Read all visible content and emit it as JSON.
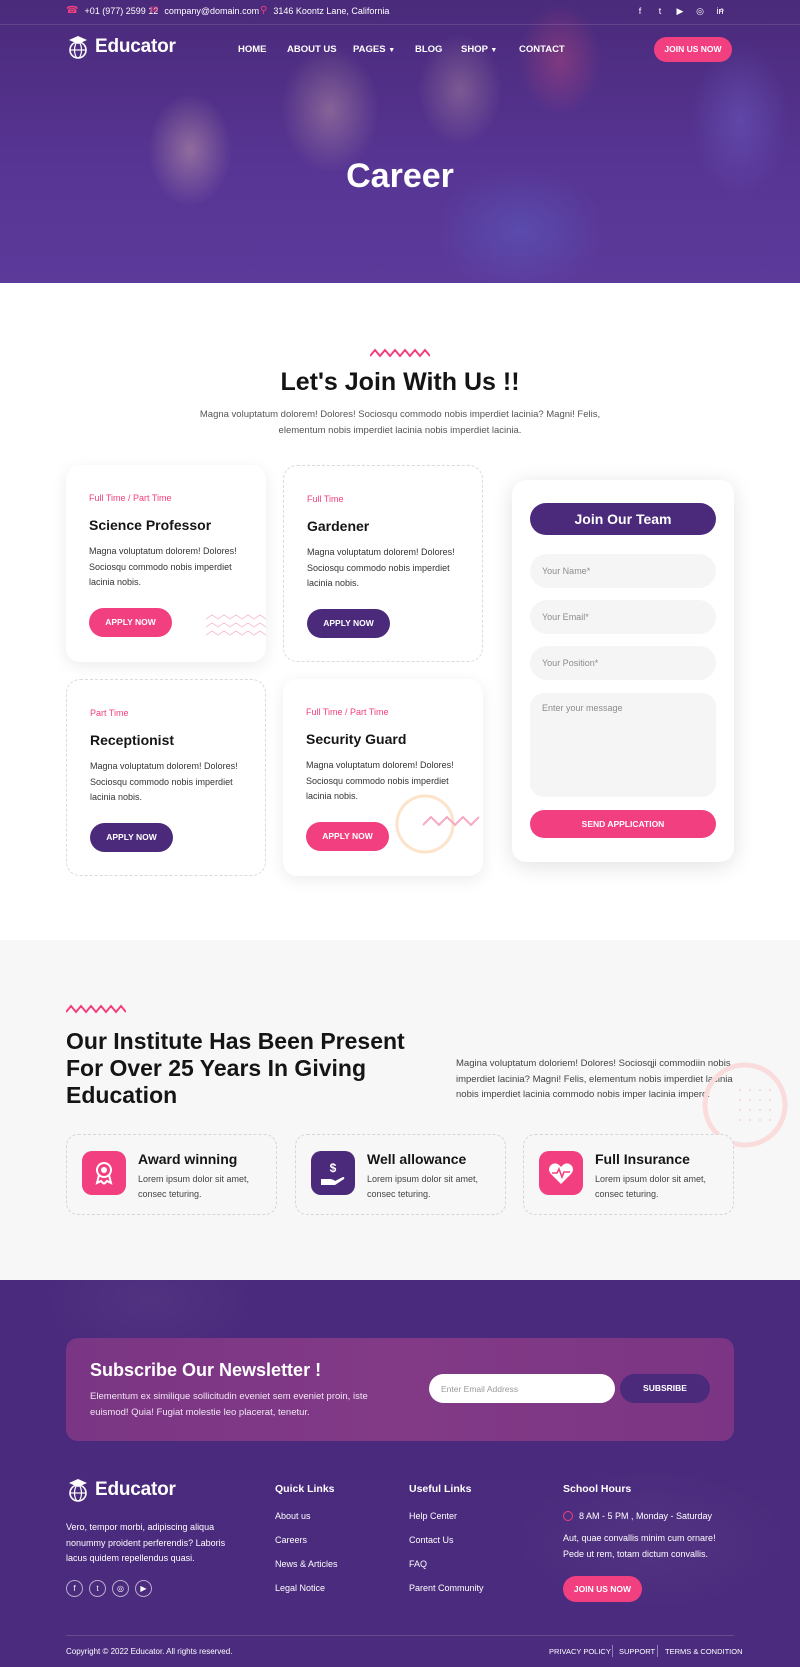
{
  "topbar": {
    "phone": "+01 (977) 2599 12",
    "email": "company@domain.com",
    "address": "3146 Koontz Lane, California",
    "social_icons": [
      "facebook-icon",
      "twitter-icon",
      "youtube-icon",
      "instagram-icon",
      "linkedin-icon",
      "search-icon"
    ]
  },
  "brand": {
    "name": "Educator"
  },
  "nav": {
    "home": "HOME",
    "about": "ABOUT US",
    "pages": "PAGES",
    "blog": "BLOG",
    "shop": "SHOP",
    "contact": "CONTACT",
    "join": "JOIN US NOW"
  },
  "hero": {
    "title": "Career"
  },
  "join_section": {
    "title": "Let's Join With Us !!",
    "subtitle_line1": "Magna voluptatum dolorem! Dolores! Sociosqu commodo nobis imperdiet lacinia? Magni! Felis,",
    "subtitle_line2": "elementum nobis imperdiet lacinia nobis imperdiet lacinia.",
    "jobs": [
      {
        "type": "Full Time / Part Time",
        "title": "Science Professor",
        "desc": "Magna voluptatum dolorem! Dolores! Sociosqu commodo nobis imperdiet lacinia nobis.",
        "button": "APPLY NOW"
      },
      {
        "type": "Full Time",
        "title": "Gardener",
        "desc": "Magna voluptatum dolorem! Dolores! Sociosqu commodo nobis imperdiet lacinia nobis.",
        "button": "APPLY NOW"
      },
      {
        "type": "Part Time",
        "title": "Receptionist",
        "desc": "Magna voluptatum dolorem! Dolores! Sociosqu commodo nobis imperdiet lacinia nobis.",
        "button": "APPLY NOW"
      },
      {
        "type": "Full Time / Part Time",
        "title": "Security Guard",
        "desc": "Magna voluptatum dolorem! Dolores! Sociosqu commodo nobis imperdiet lacinia nobis.",
        "button": "APPLY NOW"
      }
    ]
  },
  "form": {
    "title": "Join Our Team",
    "name_placeholder": "Your Name*",
    "email_placeholder": "Your Email*",
    "position_placeholder": "Your Position*",
    "message_placeholder": "Enter your message",
    "submit": "SEND APPLICATION"
  },
  "institute": {
    "title": "Our Institute Has Been Present For Over 25 Years In Giving Education",
    "text": "Magina voluptatum doloriem! Dolores! Sociosqji commodiin nobis imperdiet lacinia? Magni! Felis, elementum nobis imperdiet lacinia nobis imperdiet lacinia commodo nobis imper lacinia imperd.",
    "features": [
      {
        "title": "Award winning",
        "desc": "Lorem ipsum dolor sit amet, consec teturing."
      },
      {
        "title": "Well allowance",
        "desc": "Lorem ipsum dolor sit amet, consec teturing."
      },
      {
        "title": "Full Insurance",
        "desc": "Lorem ipsum dolor sit amet, consec teturing."
      }
    ]
  },
  "newsletter": {
    "title": "Subscribe Our Newsletter !",
    "text": "Elementum ex similique sollicitudin eveniet sem eveniet proin, iste euismod! Quia! Fugiat molestie leo placerat, tenetur.",
    "placeholder": "Enter Email Address",
    "button": "SUBSRIBE"
  },
  "footer": {
    "about": "Vero, tempor morbi, adipiscing aliqua nonummy proident perferendis? Laboris lacus quidem repellendus quasi.",
    "quick_title": "Quick Links",
    "quick": [
      "About us",
      "Careers",
      "News & Articles",
      "Legal Notice"
    ],
    "useful_title": "Useful Links",
    "useful": [
      "Help Center",
      "Contact Us",
      "FAQ",
      "Parent Community"
    ],
    "hours_title": "School Hours",
    "hours": "8 AM - 5 PM , Monday - Saturday",
    "hours_text": "Aut, quae convallis minim cum ornare! Pede ut rem, totam dictum convallis.",
    "join": "JOIN US NOW",
    "copyright": "Copyright © 2022 Educator. All rights reserved.",
    "privacy": "PRIVACY POLICY",
    "support": "SUPPORT",
    "terms": "TERMS & CONDITION"
  },
  "colors": {
    "primary": "#4b2a7c",
    "accent": "#f23f7f",
    "section_bg": "#f7f7f7"
  }
}
